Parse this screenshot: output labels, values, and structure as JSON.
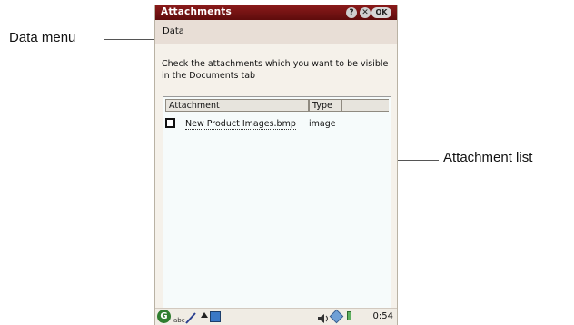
{
  "callouts": {
    "data_menu": "Data menu",
    "attachment_list": "Attachment list"
  },
  "window": {
    "title": "Attachments",
    "help_button": "?",
    "close_button": "✕",
    "ok_button": "OK"
  },
  "menu": {
    "data_label": "Data"
  },
  "instruction": "Check the attachments which you want to be visible in the Documents tab",
  "list": {
    "columns": [
      "Attachment",
      "Type"
    ],
    "rows": [
      {
        "checked": false,
        "attachment": "New Product Images.bmp",
        "type": "image"
      }
    ]
  },
  "statusbar": {
    "time": "0:54",
    "start_icon": "g-start-icon",
    "input_icon": "abc-pen-icon",
    "volume_icon": "speaker-icon",
    "battery_icon": "battery-icon"
  },
  "colors": {
    "titlebar": "#8a1a1a",
    "menubar": "#e8ded6",
    "background": "#f5f1ea",
    "list_background": "#f6fbfb"
  }
}
